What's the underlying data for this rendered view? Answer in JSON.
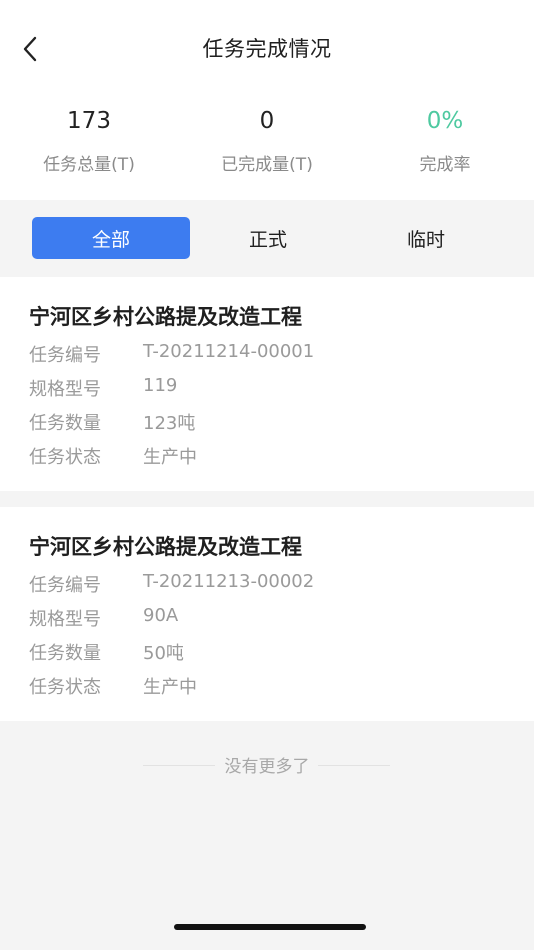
{
  "header": {
    "title": "任务完成情况",
    "back_icon": "chevron-left-icon"
  },
  "stats": [
    {
      "value": "173",
      "label": "任务总量(T)"
    },
    {
      "value": "0",
      "label": "已完成量(T)"
    },
    {
      "value": "0%",
      "label": "完成率",
      "color": "#4ec9a0"
    }
  ],
  "tabs": {
    "active_color": "#3d7cf0",
    "items": [
      {
        "label": "全部",
        "active": true
      },
      {
        "label": "正式",
        "active": false
      },
      {
        "label": "临时",
        "active": false
      }
    ]
  },
  "tasks": [
    {
      "title": "宁河区乡村公路提及改造工程",
      "fields": [
        {
          "key": "任务编号",
          "value": "T-20211214-00001"
        },
        {
          "key": "规格型号",
          "value": "119"
        },
        {
          "key": "任务数量",
          "value": "123吨"
        },
        {
          "key": "任务状态",
          "value": "生产中"
        }
      ]
    },
    {
      "title": "宁河区乡村公路提及改造工程",
      "fields": [
        {
          "key": "任务编号",
          "value": "T-20211213-00002"
        },
        {
          "key": "规格型号",
          "value": "90A"
        },
        {
          "key": "任务数量",
          "value": "50吨"
        },
        {
          "key": "任务状态",
          "value": "生产中"
        }
      ]
    }
  ],
  "footer": {
    "no_more": "没有更多了"
  }
}
